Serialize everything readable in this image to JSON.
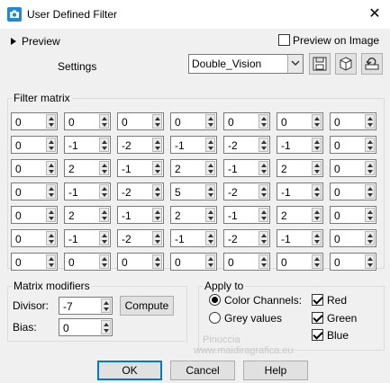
{
  "window": {
    "title": "User Defined Filter",
    "close_glyph": "✕",
    "app_icon": "camera-app-icon",
    "accent": "#0078d7"
  },
  "preview": {
    "label": "Preview",
    "on_image_label": "Preview on Image",
    "on_image_checked": false
  },
  "settings": {
    "label": "Settings",
    "preset": "Double_Vision",
    "tools": [
      "save-preset-icon",
      "cube-icon",
      "reset-icon"
    ]
  },
  "matrix": {
    "title": "Filter matrix",
    "values": [
      [
        "0",
        "0",
        "0",
        "0",
        "0",
        "0",
        "0"
      ],
      [
        "0",
        "-1",
        "-2",
        "-1",
        "-2",
        "-1",
        "0"
      ],
      [
        "0",
        "2",
        "-1",
        "2",
        "-1",
        "2",
        "0"
      ],
      [
        "0",
        "-1",
        "-2",
        "5",
        "-2",
        "-1",
        "0"
      ],
      [
        "0",
        "2",
        "-1",
        "2",
        "-1",
        "2",
        "0"
      ],
      [
        "0",
        "-1",
        "-2",
        "-1",
        "-2",
        "-1",
        "0"
      ],
      [
        "0",
        "0",
        "0",
        "0",
        "0",
        "0",
        "0"
      ]
    ]
  },
  "modifiers": {
    "title": "Matrix modifiers",
    "divisor_label": "Divisor:",
    "divisor": "-7",
    "bias_label": "Bias:",
    "bias": "0",
    "compute_label": "Compute"
  },
  "apply": {
    "title": "Apply to",
    "color_channels_label": "Color Channels:",
    "grey_values_label": "Grey values",
    "mode": "color",
    "red_label": "Red",
    "green_label": "Green",
    "blue_label": "Blue",
    "red": true,
    "green": true,
    "blue": true
  },
  "buttons": {
    "ok": "OK",
    "cancel": "Cancel",
    "help": "Help"
  },
  "watermark": {
    "line1": "Pinuccia",
    "line2": "www.maidiragrafica.eu"
  }
}
